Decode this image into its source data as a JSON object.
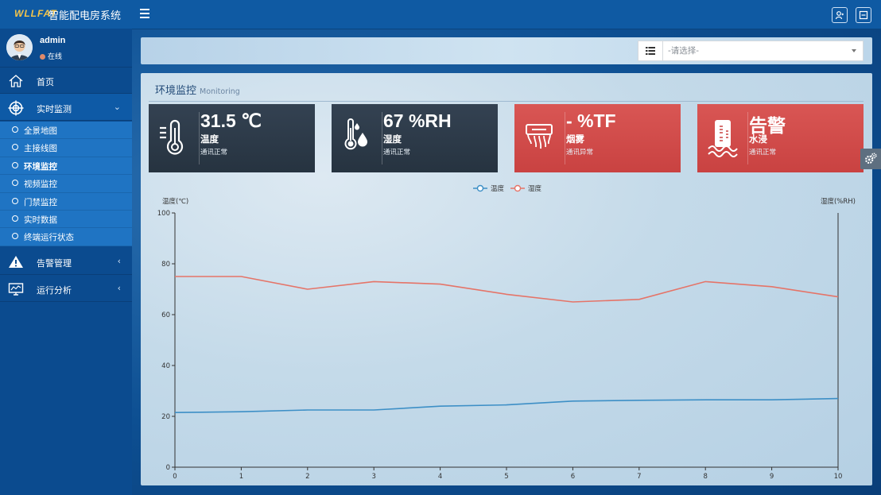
{
  "header": {
    "logo": "WLLFAT",
    "title": "智能配电房系统"
  },
  "user": {
    "name": "admin",
    "status": "在线"
  },
  "sidebar": {
    "items": [
      {
        "label": "首页",
        "icon": "home-icon"
      },
      {
        "label": "实时监测",
        "icon": "target-icon",
        "caret": "⌄"
      },
      {
        "label": "告警管理",
        "icon": "warning-icon",
        "caret": "‹"
      },
      {
        "label": "运行分析",
        "icon": "monitor-icon",
        "caret": "‹"
      }
    ],
    "sub_items": [
      {
        "label": "全景地图"
      },
      {
        "label": "主接线图"
      },
      {
        "label": "环境监控"
      },
      {
        "label": "视频监控"
      },
      {
        "label": "门禁监控"
      },
      {
        "label": "实时数据"
      },
      {
        "label": "终端运行状态"
      }
    ]
  },
  "filter": {
    "placeholder": "-请选择-"
  },
  "panel": {
    "title": "环境监控",
    "subtitle": "Monitoring"
  },
  "cards": [
    {
      "value": "31.5 ℃",
      "label": "温度",
      "status": "通讯正常",
      "icon": "thermometer-icon",
      "color": "#2c3a48"
    },
    {
      "value": "67 %RH",
      "label": "湿度",
      "status": "通讯正常",
      "icon": "humidity-icon",
      "color": "#2c3a48"
    },
    {
      "value": "- %TF",
      "label": "烟雾",
      "status": "通讯异常",
      "icon": "smoke-detector-icon",
      "color": "#d04b4a"
    },
    {
      "value": "告警",
      "label": "水浸",
      "status": "通讯正常",
      "icon": "flood-icon",
      "color": "#d04b4a"
    }
  ],
  "chart_data": {
    "type": "line",
    "x": [
      0,
      1,
      2,
      3,
      4,
      5,
      6,
      7,
      8,
      9,
      10
    ],
    "series": [
      {
        "name": "温度",
        "color": "#3d8fc6",
        "values": [
          21.5,
          21.8,
          22.5,
          22.5,
          24.0,
          24.5,
          26.0,
          26.3,
          26.5,
          26.5,
          27.0
        ]
      },
      {
        "name": "湿度",
        "color": "#e57468",
        "values": [
          75,
          75,
          70,
          73,
          72,
          68,
          65,
          66,
          73,
          71,
          67
        ]
      }
    ],
    "ylabel": "温度(℃)",
    "ylabel_right": "湿度(%RH)",
    "ylim": [
      0,
      100
    ],
    "yticks": [
      0,
      20,
      40,
      60,
      80,
      100
    ],
    "legend": "top-center"
  }
}
